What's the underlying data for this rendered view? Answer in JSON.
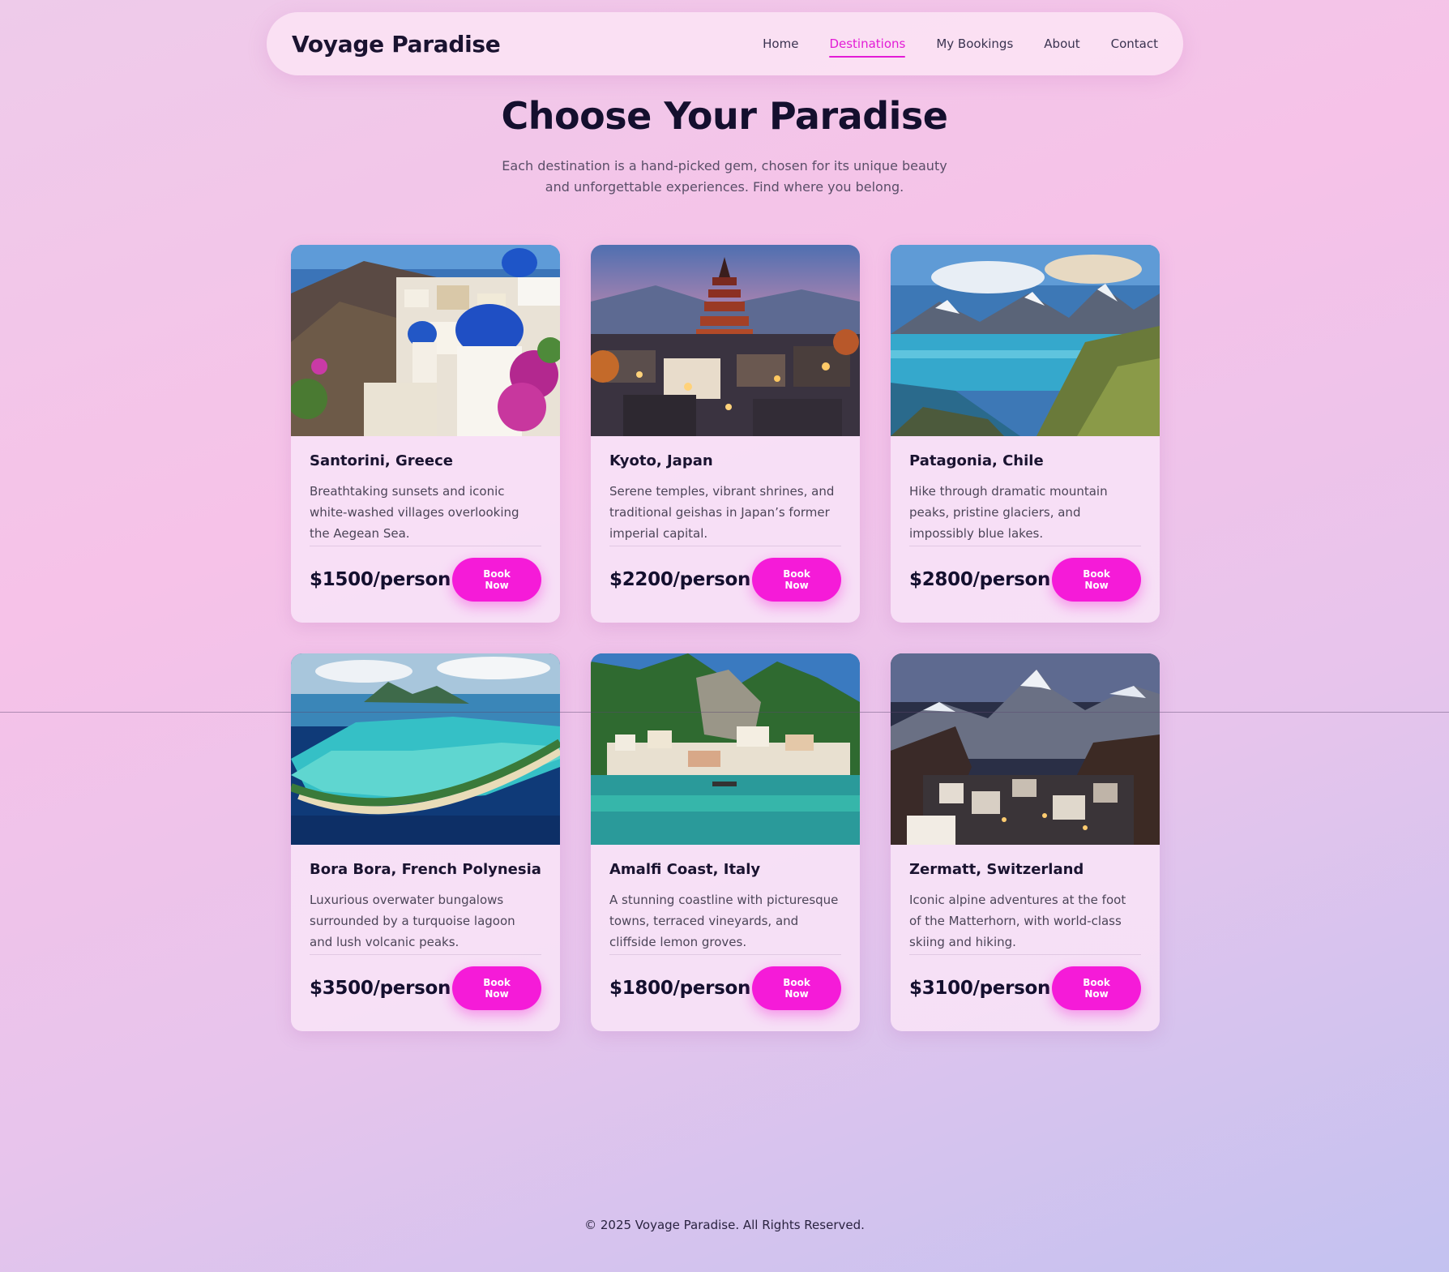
{
  "header": {
    "brand": "Voyage Paradise",
    "nav": [
      {
        "label": "Home",
        "active": false
      },
      {
        "label": "Destinations",
        "active": true
      },
      {
        "label": "My Bookings",
        "active": false
      },
      {
        "label": "About",
        "active": false
      },
      {
        "label": "Contact",
        "active": false
      }
    ]
  },
  "hero": {
    "title": "Choose Your Paradise",
    "subtitle": "Each destination is a hand-picked gem, chosen for its unique beauty and unforgettable experiences. Find where you belong."
  },
  "destinations": [
    {
      "name": "Santorini, Greece",
      "description": "Breathtaking sunsets and iconic white-washed villages overlooking the Aegean Sea.",
      "price": "$1500/person",
      "button": "Book Now"
    },
    {
      "name": "Kyoto, Japan",
      "description": "Serene temples, vibrant shrines, and traditional geishas in Japan’s former imperial capital.",
      "price": "$2200/person",
      "button": "Book Now"
    },
    {
      "name": "Patagonia, Chile",
      "description": "Hike through dramatic mountain peaks, pristine glaciers, and impossibly blue lakes.",
      "price": "$2800/person",
      "button": "Book Now"
    },
    {
      "name": "Bora Bora, French Polynesia",
      "description": "Luxurious overwater bungalows surrounded by a turquoise lagoon and lush volcanic peaks.",
      "price": "$3500/person",
      "button": "Book Now"
    },
    {
      "name": "Amalfi Coast, Italy",
      "description": "A stunning coastline with picturesque towns, terraced vineyards, and cliffside lemon groves.",
      "price": "$1800/person",
      "button": "Book Now"
    },
    {
      "name": "Zermatt, Switzerland",
      "description": "Iconic alpine adventures at the foot of the Matterhorn, with world-class skiing and hiking.",
      "price": "$3100/person",
      "button": "Book Now"
    }
  ],
  "footer": {
    "copyright": "© 2025 Voyage Paradise. All Rights Reserved."
  },
  "colors": {
    "accent": "#f51bd8",
    "active_nav": "#e31bd6",
    "text_dark": "#140f2e"
  }
}
